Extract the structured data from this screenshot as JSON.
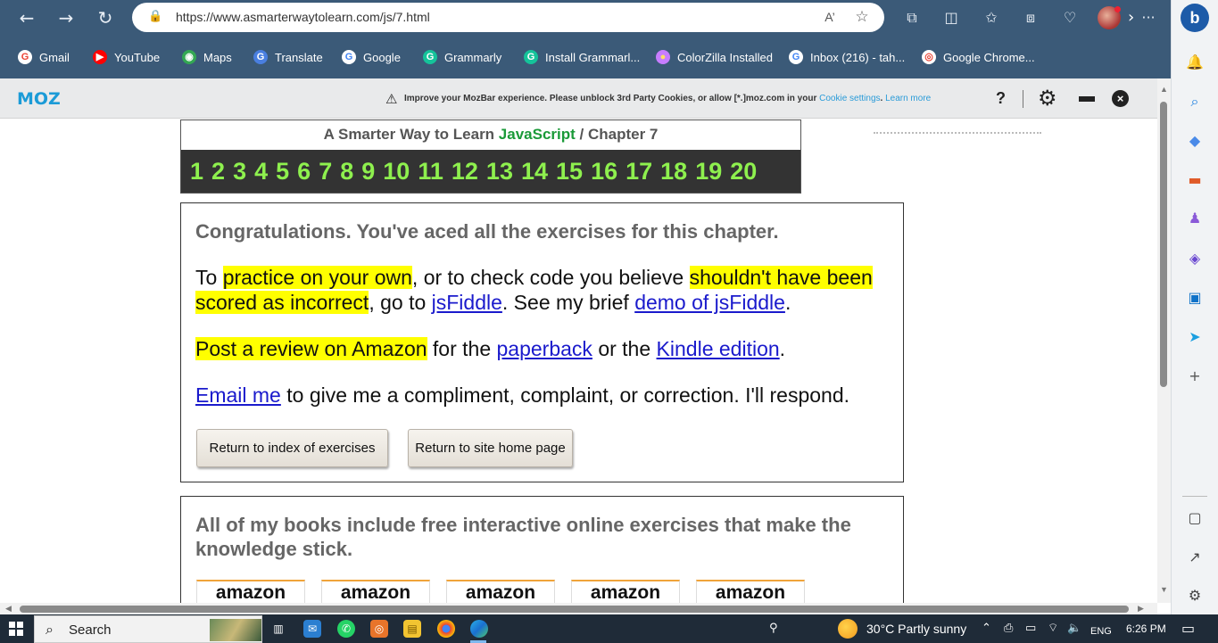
{
  "browser": {
    "url": "https://www.asmarterwaytolearn.com/js/7.html",
    "nav": {
      "back_icon": "←",
      "forward_icon": "→",
      "refresh_icon": "↻"
    },
    "address_icons": {
      "lock": "🔒",
      "read_aloud": "A’",
      "favorite": "☆"
    },
    "toolbar_icons": {
      "extensions": "⧉",
      "split": "◫",
      "favorites": "✩",
      "collections": "⧈",
      "performance": "♡",
      "more": "···"
    },
    "bookmarks": [
      {
        "label": "Gmail",
        "color": "#ffffff",
        "glyph": "G",
        "glyph_color": "#ea4335"
      },
      {
        "label": "YouTube",
        "color": "#ff0000",
        "glyph": "▶",
        "glyph_color": "#ffffff"
      },
      {
        "label": "Maps",
        "color": "#34a853",
        "glyph": "◉",
        "glyph_color": "#ffffff"
      },
      {
        "label": "Translate",
        "color": "#4a7fe0",
        "glyph": "G",
        "glyph_color": "#ffffff"
      },
      {
        "label": "Google",
        "color": "#ffffff",
        "glyph": "G",
        "glyph_color": "#4285f4"
      },
      {
        "label": "Grammarly",
        "color": "#15c39a",
        "glyph": "G",
        "glyph_color": "#ffffff"
      },
      {
        "label": "Install Grammarl...",
        "color": "#15c39a",
        "glyph": "G",
        "glyph_color": "#ffffff"
      },
      {
        "label": "ColorZilla Installed",
        "color": "#c77dff",
        "glyph": "●",
        "glyph_color": "#ffe066"
      },
      {
        "label": "Inbox (216) - tah...",
        "color": "#ffffff",
        "glyph": "G",
        "glyph_color": "#4285f4"
      },
      {
        "label": "Google Chrome...",
        "color": "#ffffff",
        "glyph": "◎",
        "glyph_color": "#ea4335"
      }
    ],
    "bookmarks_more": "›"
  },
  "sidebar": {
    "bing": "b",
    "icons": [
      {
        "name": "bell-icon",
        "glyph": "🔔",
        "color": "#1b7fe0"
      },
      {
        "name": "search-icon",
        "glyph": "⌕",
        "color": "#1b7fe0"
      },
      {
        "name": "tag-icon",
        "glyph": "◆",
        "color": "#4a8ae8"
      },
      {
        "name": "toolbox-icon",
        "glyph": "▬",
        "color": "#e05a28"
      },
      {
        "name": "people-icon",
        "glyph": "♟",
        "color": "#8a5ad8"
      },
      {
        "name": "office-icon",
        "glyph": "◈",
        "color": "#6a48d0"
      },
      {
        "name": "outlook-icon",
        "glyph": "▣",
        "color": "#0f72c8"
      },
      {
        "name": "send-icon",
        "glyph": "➤",
        "color": "#1b9fe0"
      },
      {
        "name": "add-icon",
        "glyph": "+",
        "color": "#555555"
      },
      {
        "name": "split-screen-icon",
        "glyph": "▢",
        "color": "#444444"
      },
      {
        "name": "open-external-icon",
        "glyph": "↗",
        "color": "#444444"
      },
      {
        "name": "settings-icon",
        "glyph": "⚙",
        "color": "#444444"
      }
    ]
  },
  "mozbar": {
    "logo": "MOZ",
    "warning_icon": "⚠",
    "message": "Improve your MozBar experience. Please unblock 3rd Party Cookies, or allow [*.]moz.com in your ",
    "cookie_link": "Cookie settings",
    "learn_more": "Learn more",
    "help": "?",
    "gear": "⚙",
    "close": "×"
  },
  "chapter": {
    "title_prefix": "A Smarter Way to Learn ",
    "title_js": "JavaScript",
    "title_suffix": " / Chapter 7",
    "numbers": [
      "1",
      "2",
      "3",
      "4",
      "5",
      "6",
      "7",
      "8",
      "9",
      "10",
      "11",
      "12",
      "13",
      "14",
      "15",
      "16",
      "17",
      "18",
      "19",
      "20"
    ]
  },
  "congrats": {
    "title": "Congratulations. You've aced all the exercises for this chapter.",
    "p1_a": "To ",
    "p1_hl1": "practice on your own",
    "p1_b": ", or to check code you believe ",
    "p1_hl2": "shouldn't have been scored as incorrect",
    "p1_c": ", go to ",
    "p1_link1": "jsFiddle",
    "p1_d": ". See my brief ",
    "p1_link2": "demo of jsFiddle",
    "p1_e": ".",
    "p2_hl": "Post a review on Amazon",
    "p2_a": " for the ",
    "p2_link1": "paperback",
    "p2_b": " or the ",
    "p2_link2": "Kindle edition",
    "p2_c": ".",
    "p3_link": "Email me",
    "p3_a": " to give me a compliment, complaint, or correction. I'll respond.",
    "btn_index": "Return to index of exercises",
    "btn_home": "Return to site home page"
  },
  "books": {
    "text": "All of my books include free interactive online exercises that make the knowledge stick.",
    "amazon_labels": [
      "amazon",
      "amazon",
      "amazon",
      "amazon",
      "amazon"
    ]
  },
  "taskbar": {
    "search_placeholder": "Search",
    "search_icon": "⌕",
    "weather": "30°C  Partly sunny",
    "language": "ENG",
    "time": "6:26 PM",
    "tray_chevron": "⌃",
    "notification_icon": "▭"
  }
}
